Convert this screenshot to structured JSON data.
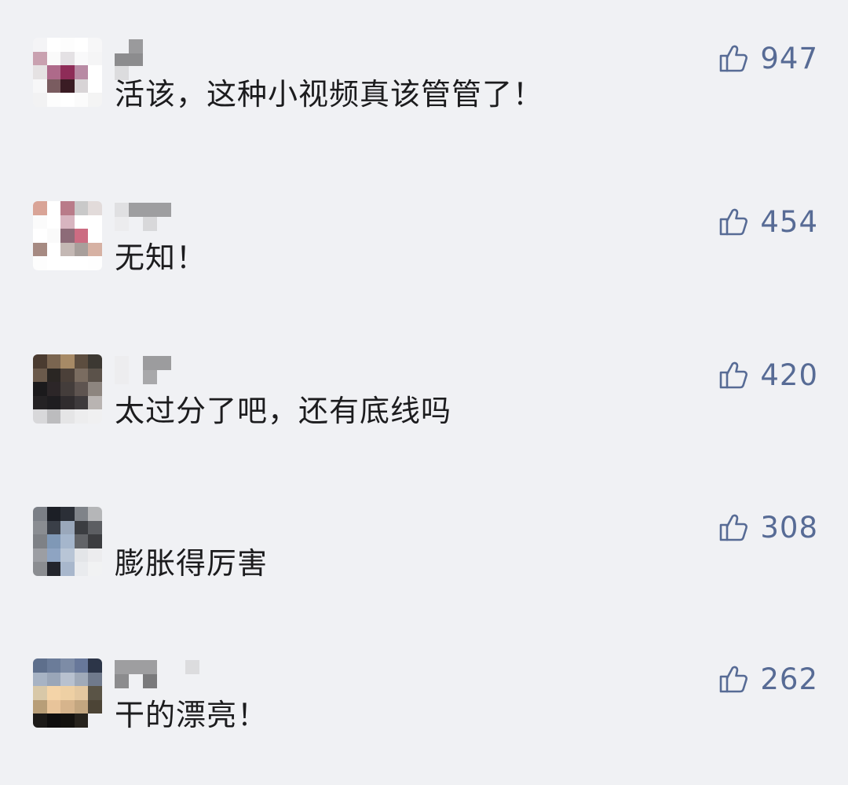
{
  "colors": {
    "background": "#f0f1f4",
    "text": "#1c1c1e",
    "like_accent": "#576b95"
  },
  "like_icon": "thumbs-up-icon",
  "comments": [
    {
      "text": "活该，这种小视频真该管管了！",
      "likes": "947",
      "avatar_palette": [
        "#f4f4f6",
        "#ffffff",
        "#fdfdfd",
        "#ffffff",
        "#f7f7f8",
        "#c9a1b0",
        "#fafafa",
        "#e4e1e4",
        "#f9f9fa",
        "#f5f5f6",
        "#e5e2e3",
        "#ae6a8a",
        "#8e2c58",
        "#b88aa4",
        "#ffffff",
        "#f7f7f8",
        "#7a5c60",
        "#3a1c24",
        "#d8d4d6",
        "#ffffff",
        "#f2f2f3",
        "#fdfdfd",
        "#ffffff",
        "#fbfbfb",
        "#f4f4f4"
      ]
    },
    {
      "text": "无知！",
      "likes": "454",
      "avatar_palette": [
        "#d9a497",
        "#ffffff",
        "#b97b89",
        "#c9c9c9",
        "#e2dbda",
        "#fbfbfb",
        "#ffffff",
        "#d8b5c0",
        "#ffffff",
        "#ffffff",
        "#ffffff",
        "#fafafa",
        "#8d6b78",
        "#cc6c82",
        "#ffffff",
        "#a68a82",
        "#ffffff",
        "#c4b8b4",
        "#a89f9b",
        "#d6b1a3",
        "#fdfdfd",
        "#ffffff",
        "#ffffff",
        "#ffffff",
        "#fefefe"
      ]
    },
    {
      "text": "太过分了吧，还有底线吗",
      "likes": "420",
      "avatar_palette": [
        "#4a3b30",
        "#7a6550",
        "#a78a66",
        "#5c4d3f",
        "#3c3832",
        "#6b5a4b",
        "#2a2623",
        "#4b4039",
        "#7a6c60",
        "#5b524a",
        "#1b1a1c",
        "#2c2628",
        "#443d3b",
        "#5e5450",
        "#8d857f",
        "#242224",
        "#1e1d20",
        "#302c2e",
        "#3e3a3c",
        "#b9b4b2",
        "#d8d8da",
        "#bcbcbe",
        "#e5e5e6",
        "#ededee",
        "#f0f0f1"
      ]
    },
    {
      "text": "膨胀得厉害",
      "likes": "308",
      "avatar_palette": [
        "#7b7f86",
        "#1c1f26",
        "#2b2f37",
        "#7f8389",
        "#b5b6b8",
        "#8a8d92",
        "#3a3f48",
        "#9aa8bb",
        "#3b3d41",
        "#5c5e62",
        "#7e8186",
        "#7f98b6",
        "#a5b6cc",
        "#626468",
        "#3c3d40",
        "#9c9ea3",
        "#8ea4c2",
        "#b8c5d6",
        "#e3e5e8",
        "#ececee",
        "#8b8d91",
        "#23252c",
        "#a8b7cc",
        "#e9ebee",
        "#f1f2f3"
      ]
    },
    {
      "text": "干的漂亮！",
      "likes": "262",
      "avatar_palette": [
        "#5e6f8c",
        "#6b7c99",
        "#7d8ca6",
        "#68789a",
        "#2c3548",
        "#a7b3c4",
        "#9aa6b8",
        "#b8c1cf",
        "#a0aab9",
        "#707a8c",
        "#d8c8a8",
        "#f4d4a8",
        "#eed0a4",
        "#e4c8a0",
        "#5a5446",
        "#b89e78",
        "#e8c49a",
        "#d6b48c",
        "#c3a680",
        "#4c4436",
        "#1c1a18",
        "#0f0e0e",
        "#14120f",
        "#27231d",
        "#f0f1f4"
      ]
    }
  ]
}
